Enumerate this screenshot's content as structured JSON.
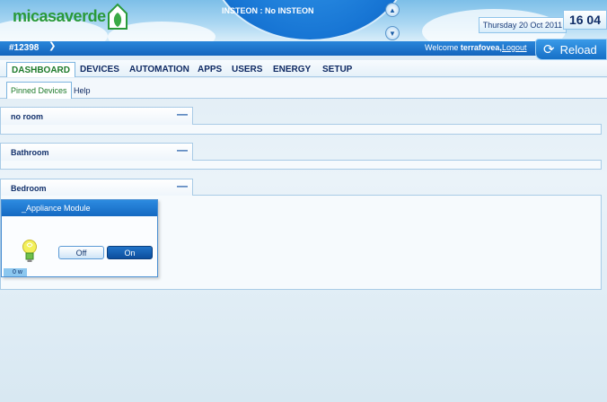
{
  "header": {
    "logo_text": "micasaverde",
    "dome_text": "INSTEON : No INSTEON",
    "date": "Thursday 20 Oct 2011",
    "time": "16 04"
  },
  "topbar": {
    "unit_id": "#12398",
    "welcome_prefix": "Welcome",
    "username": "terrafovea,",
    "logout_label": "Logout",
    "reload_label": "Reload"
  },
  "nav": {
    "tabs": [
      {
        "label": "DASHBOARD"
      },
      {
        "label": "DEVICES"
      },
      {
        "label": "AUTOMATION"
      },
      {
        "label": "APPS"
      },
      {
        "label": "USERS"
      },
      {
        "label": "ENERGY"
      },
      {
        "label": "SETUP"
      }
    ],
    "active": "DASHBOARD"
  },
  "subnav": {
    "tabs": [
      {
        "label": "Pinned Devices"
      },
      {
        "label": "Help"
      }
    ]
  },
  "rooms": [
    {
      "name": "no room",
      "collapse": "—"
    },
    {
      "name": "Bathroom",
      "collapse": "—"
    },
    {
      "name": "Bedroom",
      "collapse": "—"
    }
  ],
  "device": {
    "name": "_Appliance Module",
    "off_label": "Off",
    "on_label": "On",
    "power": "0 w",
    "state": "on"
  },
  "colors": {
    "accent": "#1670c7",
    "active_tab_text": "#1d7a2a",
    "logo_green": "#2a9a3a"
  },
  "icons": [
    "leaf-icon",
    "arrow-up-icon",
    "arrow-down-icon",
    "chevron-down-icon",
    "reload-icon",
    "collapse-icon",
    "bulb-icon"
  ]
}
